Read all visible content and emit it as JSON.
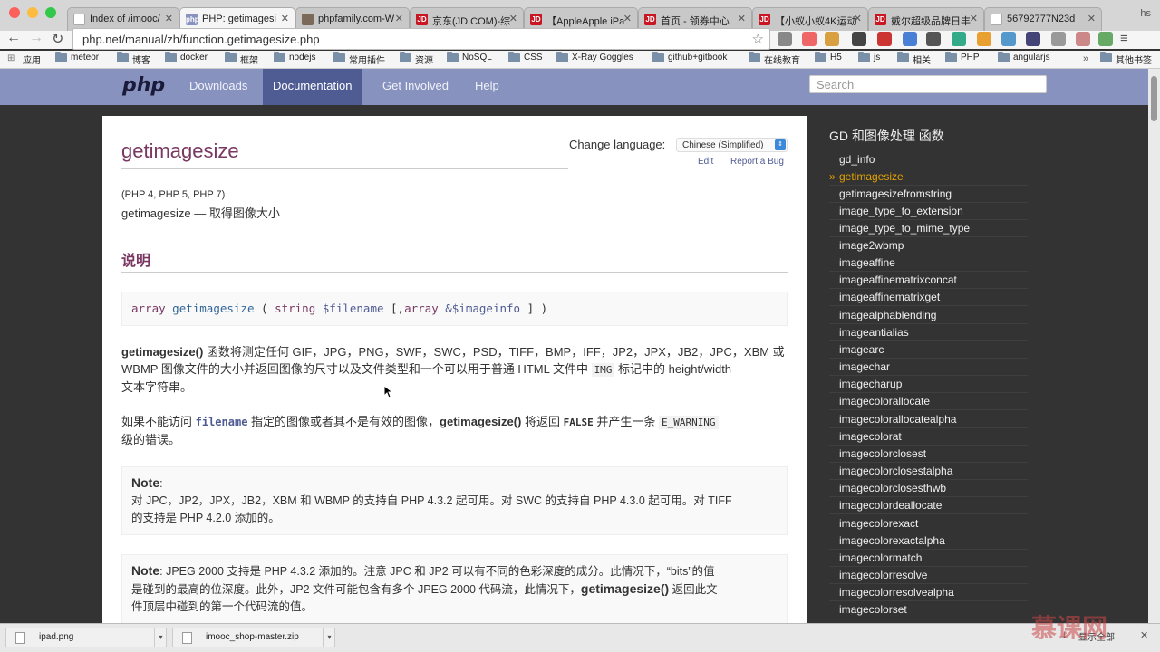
{
  "browser": {
    "profile": "hs",
    "tabs": [
      {
        "label": "Index of /imooc/",
        "icon": "document-icon"
      },
      {
        "label": "PHP: getimagesi",
        "icon": "php-icon",
        "active": true
      },
      {
        "label": "phpfamily.com-W",
        "icon": "globe-icon"
      },
      {
        "label": "京东(JD.COM)-综",
        "icon": "jd-icon"
      },
      {
        "label": "【AppleApple iPa",
        "icon": "jd-icon"
      },
      {
        "label": "首页 - 领券中心",
        "icon": "jd-icon"
      },
      {
        "label": "【小蚁小蚁4K运动",
        "icon": "jd-icon"
      },
      {
        "label": "戴尔超级品牌日丰",
        "icon": "jd-icon"
      },
      {
        "label": "56792777N23d",
        "icon": "document-icon"
      }
    ],
    "url": "php.net/manual/zh/function.getimagesize.php",
    "bookmarks": [
      "应用",
      "meteor",
      "博客",
      "docker",
      "框架",
      "nodejs",
      "常用插件",
      "资源",
      "NoSQL",
      "CSS",
      "X-Ray Goggles",
      "github+gitbook",
      "在线教育",
      "H5",
      "js",
      "相关",
      "PHP",
      "angularjs"
    ],
    "bookmarks_more": "»",
    "bookmarks_other": "其他书签"
  },
  "php": {
    "logo": "php",
    "nav": [
      "Downloads",
      "Documentation",
      "Get Involved",
      "Help"
    ],
    "search_placeholder": "Search"
  },
  "page": {
    "title": "getimagesize",
    "change_language": "Change language:",
    "language": "Chinese (Simplified)",
    "edit": "Edit",
    "report_bug": "Report a Bug",
    "versions": "(PHP 4, PHP 5, PHP 7)",
    "refpurpose": "getimagesize — 取得图像大小",
    "section": "说明",
    "synopsis": {
      "type": "array",
      "name": "getimagesize",
      "open": "(",
      "p1_type": "string",
      "p1_name": "$filename",
      "opt_open": "[,",
      "p2_type": "array",
      "p2_name": "&$imageinfo",
      "close": "] )"
    },
    "para1_bold": "getimagesize()",
    "para1_line1": " 函数将测定任何 GIF，JPG，PNG，SWF，SWC，PSD，TIFF，BMP，IFF，JP2，JPX，JB2，JPC，XBM 或",
    "para1_line2a": "WBMP 图像文件的大小并返回图像的尺寸以及文件类型和一个可以用于普通 HTML 文件中 ",
    "para1_code": "IMG",
    "para1_line2b": " 标记中的 height/width",
    "para1_line3": "文本字符串。",
    "para2_a": "如果不能访问 ",
    "para2_param": "filename",
    "para2_b": " 指定的图像或者其不是有效的图像，",
    "para2_fn": "getimagesize()",
    "para2_c": " 将返回 ",
    "para2_false": "FALSE",
    "para2_d": " 并产生一条 ",
    "para2_code": "E_WARNING",
    "para2_e": "级的错误。",
    "note1_label": "Note",
    "note1_colon": ":",
    "note1_line1": "对 JPC，JP2，JPX，JB2，XBM 和 WBMP 的支持自 PHP 4.3.2 起可用。对 SWC 的支持自 PHP 4.3.0 起可用。对 TIFF",
    "note1_line2": "的支持是 PHP 4.2.0 添加的。",
    "note2_label": "Note",
    "note2_line1": ": JPEG 2000 支持是 PHP 4.3.2 添加的。注意 JPC 和 JP2 可以有不同的色彩深度的成分。此情况下，“bits”的值",
    "note2_line2a": "是碰到的最高的位深度。此外，JP2 文件可能包含有多个 JPEG 2000 代码流，此情况下，",
    "note2_fn": "getimagesize()",
    "note2_line2b": " 返回此文",
    "note2_line3": "件顶层中碰到的第一个代码流的值。"
  },
  "sidebar": {
    "title": "GD 和图像处理 函数",
    "current_marker": "»",
    "items": [
      {
        "label": "gd_info"
      },
      {
        "label": "getimagesize",
        "current": true
      },
      {
        "label": "getimagesizefromstring"
      },
      {
        "label": "image_type_to_extension"
      },
      {
        "label": "image_type_to_mime_type"
      },
      {
        "label": "image2wbmp"
      },
      {
        "label": "imageaffine"
      },
      {
        "label": "imageaffinematrixconcat"
      },
      {
        "label": "imageaffinematrixget"
      },
      {
        "label": "imagealphablending"
      },
      {
        "label": "imageantialias"
      },
      {
        "label": "imagearc"
      },
      {
        "label": "imagechar"
      },
      {
        "label": "imagecharup"
      },
      {
        "label": "imagecolorallocate"
      },
      {
        "label": "imagecolorallocatealpha"
      },
      {
        "label": "imagecolorat"
      },
      {
        "label": "imagecolorclosest"
      },
      {
        "label": "imagecolorclosestalpha"
      },
      {
        "label": "imagecolorclosesthwb"
      },
      {
        "label": "imagecolordeallocate"
      },
      {
        "label": "imagecolorexact"
      },
      {
        "label": "imagecolorexactalpha"
      },
      {
        "label": "imagecolormatch"
      },
      {
        "label": "imagecolorresolve"
      },
      {
        "label": "imagecolorresolvealpha"
      },
      {
        "label": "imagecolorset"
      }
    ]
  },
  "downloads": {
    "items": [
      "ipad.png",
      "imooc_shop-master.zip"
    ],
    "show_all": "显示全部",
    "watermark": "慕课网"
  },
  "colors": {
    "php_header": "#8892bf",
    "php_nav_active": "#4f5b93",
    "title": "#793862",
    "sidebar_current": "#e2a300"
  }
}
